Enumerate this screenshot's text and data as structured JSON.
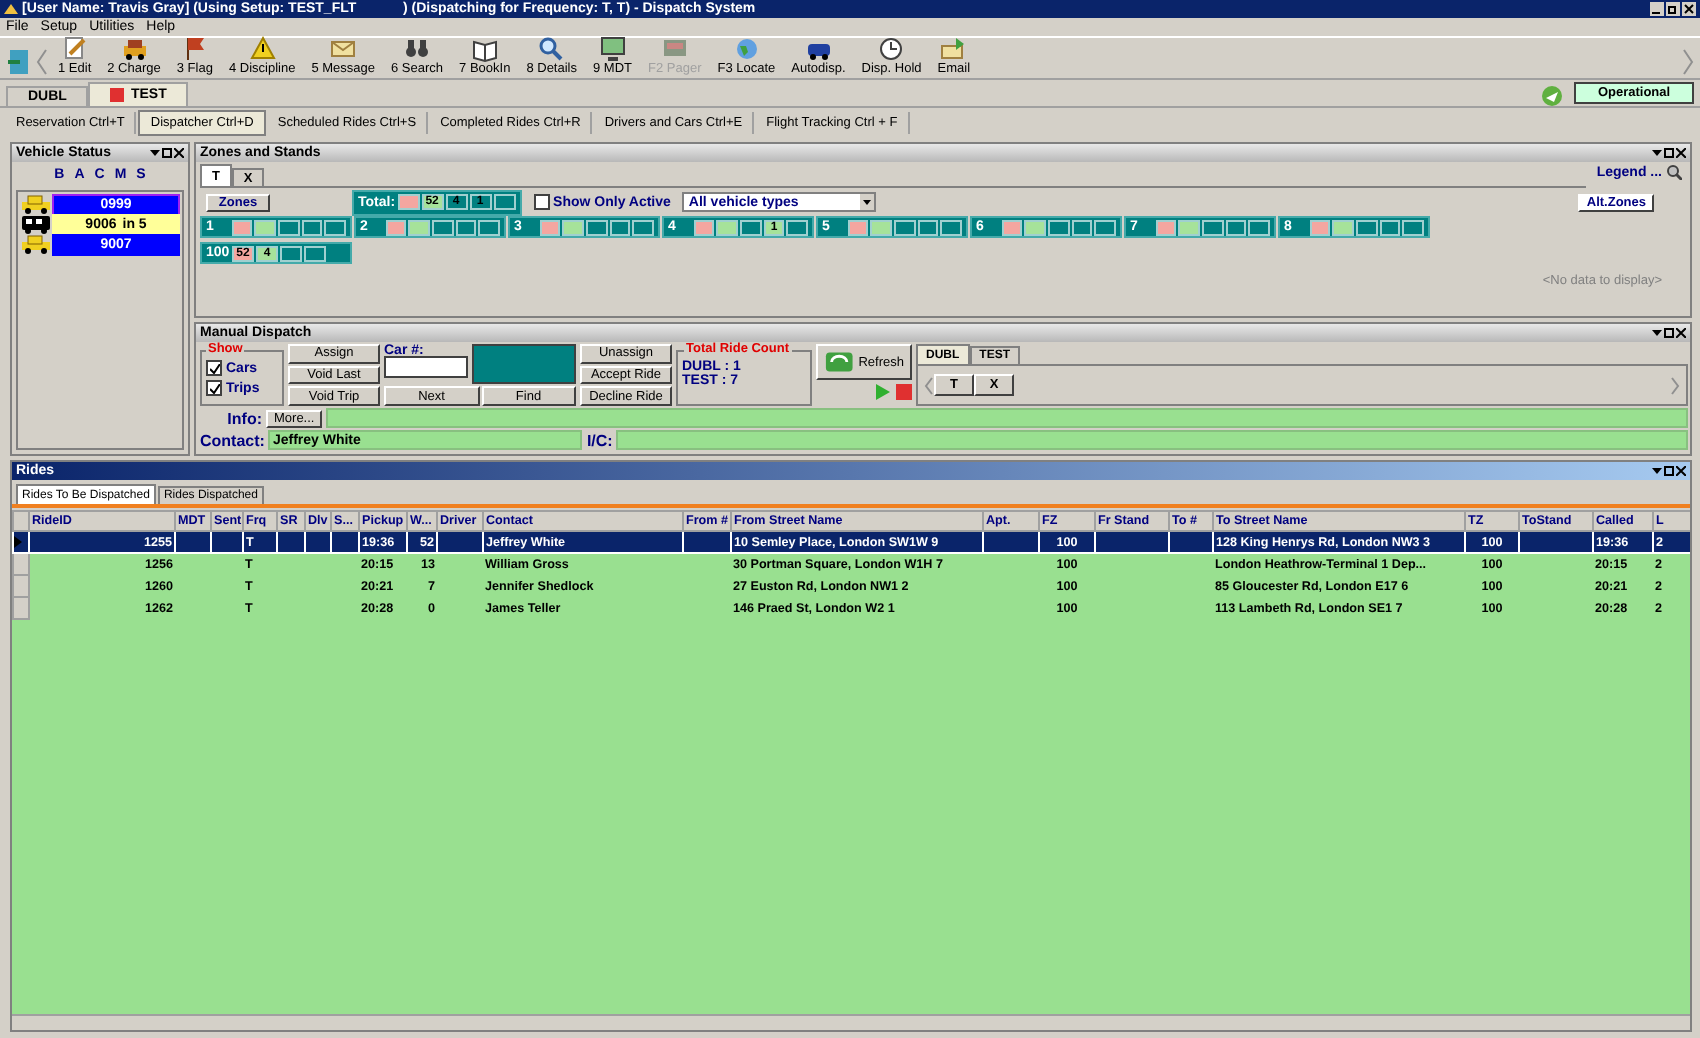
{
  "window": {
    "title": "[User Name: Travis Gray] (Using Setup: TEST_FLT            ) (Dispatching for Frequency: T, T) - Dispatch System"
  },
  "menu": [
    "File",
    "Setup",
    "Utilities",
    "Help"
  ],
  "toolbar": [
    {
      "label": "1 Edit",
      "disabled": false
    },
    {
      "label": "2 Charge",
      "disabled": false
    },
    {
      "label": "3 Flag",
      "disabled": false
    },
    {
      "label": "4 Discipline",
      "disabled": false
    },
    {
      "label": "5 Message",
      "disabled": false
    },
    {
      "label": "6 Search",
      "disabled": false
    },
    {
      "label": "7 BookIn",
      "disabled": false
    },
    {
      "label": "8 Details",
      "disabled": false
    },
    {
      "label": "9 MDT",
      "disabled": false
    },
    {
      "label": "F2 Pager",
      "disabled": true
    },
    {
      "label": "F3 Locate",
      "disabled": false
    },
    {
      "label": "Autodisp.",
      "disabled": false
    },
    {
      "label": "Disp. Hold",
      "disabled": false
    },
    {
      "label": "Email",
      "disabled": false
    }
  ],
  "frequency_tabs": [
    {
      "label": "DUBL",
      "selected": false
    },
    {
      "label": "TEST",
      "selected": true
    }
  ],
  "status_button": {
    "label": "Operational"
  },
  "function_tabs": [
    {
      "label": "Reservation Ctrl+T",
      "selected": false
    },
    {
      "label": "Dispatcher Ctrl+D",
      "selected": true
    },
    {
      "label": "Scheduled Rides Ctrl+S",
      "selected": false
    },
    {
      "label": "Completed Rides Ctrl+R",
      "selected": false
    },
    {
      "label": "Drivers and Cars Ctrl+E",
      "selected": false
    },
    {
      "label": "Flight Tracking Ctrl + F",
      "selected": false
    }
  ],
  "vehicle_status": {
    "title": "Vehicle Status",
    "columns": [
      "B",
      "A",
      "C",
      "M",
      "S"
    ],
    "vehicles": [
      {
        "number": "0999",
        "kind": "taxi",
        "color": "#0000ff",
        "selected": true
      },
      {
        "number": "9006",
        "note": "in 5",
        "kind": "van",
        "color": "#ffff99",
        "selected": false
      },
      {
        "number": "9007",
        "kind": "taxi",
        "color": "#0000ff",
        "selected": false
      }
    ]
  },
  "zones_and_stands": {
    "title": "Zones and Stands",
    "tabs": [
      {
        "label": "T",
        "selected": true
      },
      {
        "label": "X",
        "selected": false
      }
    ],
    "legend": "Legend ...",
    "zones_button": "Zones",
    "total": {
      "label": "Total:",
      "cells": [
        {
          "color": "#f4a6a0"
        },
        {
          "color": "#a6e29a",
          "text": "52"
        },
        {
          "color": "#008080",
          "text": "4"
        },
        {
          "color": "#008080",
          "text": "1"
        },
        {
          "color": "#008080"
        }
      ]
    },
    "show_only_active": {
      "label": "Show Only Active",
      "checked": false
    },
    "vehicle_type": {
      "value": "All vehicle types"
    },
    "alt_zones": "Alt.Zones",
    "zones": [
      {
        "label": "1",
        "cells": [
          {
            "color": "#f4a6a0"
          },
          {
            "color": "#a6e29a"
          },
          {
            "color": "#008080"
          },
          {
            "color": "#008080"
          },
          {
            "color": "#008080"
          }
        ]
      },
      {
        "label": "2",
        "cells": [
          {
            "color": "#f4a6a0"
          },
          {
            "color": "#a6e29a"
          },
          {
            "color": "#008080"
          },
          {
            "color": "#008080"
          },
          {
            "color": "#008080"
          }
        ]
      },
      {
        "label": "3",
        "cells": [
          {
            "color": "#f4a6a0"
          },
          {
            "color": "#a6e29a"
          },
          {
            "color": "#008080"
          },
          {
            "color": "#008080"
          },
          {
            "color": "#008080"
          }
        ]
      },
      {
        "label": "4",
        "cells": [
          {
            "color": "#f4a6a0"
          },
          {
            "color": "#a6e29a"
          },
          {
            "color": "#008080"
          },
          {
            "color": "#a6e29a",
            "text": "1"
          },
          {
            "color": "#008080"
          }
        ]
      },
      {
        "label": "5",
        "cells": [
          {
            "color": "#f4a6a0"
          },
          {
            "color": "#a6e29a"
          },
          {
            "color": "#008080"
          },
          {
            "color": "#008080"
          },
          {
            "color": "#008080"
          }
        ]
      },
      {
        "label": "6",
        "cells": [
          {
            "color": "#f4a6a0"
          },
          {
            "color": "#a6e29a"
          },
          {
            "color": "#008080"
          },
          {
            "color": "#008080"
          },
          {
            "color": "#008080"
          }
        ]
      },
      {
        "label": "7",
        "cells": [
          {
            "color": "#f4a6a0"
          },
          {
            "color": "#a6e29a"
          },
          {
            "color": "#008080"
          },
          {
            "color": "#008080"
          },
          {
            "color": "#008080"
          }
        ]
      },
      {
        "label": "8",
        "cells": [
          {
            "color": "#f4a6a0"
          },
          {
            "color": "#a6e29a"
          },
          {
            "color": "#008080"
          },
          {
            "color": "#008080"
          },
          {
            "color": "#008080"
          }
        ]
      },
      {
        "label": "100",
        "cells": [
          {
            "color": "#f4a6a0",
            "text": "52"
          },
          {
            "color": "#a6e29a",
            "text": "4"
          },
          {
            "color": "#008080"
          },
          {
            "color": "#008080"
          }
        ]
      }
    ],
    "empty_message": "<No data to display>"
  },
  "manual_dispatch": {
    "title": "Manual Dispatch",
    "show": {
      "label": "Show",
      "options": [
        {
          "label": "Cars",
          "checked": true
        },
        {
          "label": "Trips",
          "checked": true
        }
      ]
    },
    "left_buttons": [
      "Assign",
      "Void Last",
      "Void Trip"
    ],
    "car_label": "Car #:",
    "middle_buttons": [
      "Next",
      "Find"
    ],
    "right_buttons": [
      "Unassign",
      "Accept Ride",
      "Decline Ride"
    ],
    "ride_count": {
      "label": "Total Ride Count",
      "lines": [
        "DUBL : 1",
        "TEST : 7"
      ]
    },
    "refresh": "Refresh",
    "tabs": [
      {
        "label": "DUBL",
        "selected": true
      },
      {
        "label": "TEST",
        "selected": false
      }
    ],
    "frequency_buttons": [
      "T",
      "X"
    ],
    "info": {
      "label": "Info:",
      "button": "More..."
    },
    "contact": {
      "label": "Contact:",
      "value": "Jeffrey White"
    },
    "ic": {
      "label": "I/C:"
    }
  },
  "rides": {
    "title": "Rides",
    "tabs": [
      {
        "label": "Rides To Be Dispatched",
        "selected": true
      },
      {
        "label": "Rides Dispatched",
        "selected": false
      }
    ],
    "columns": [
      "RideID",
      "MDT",
      "Sent",
      "Frq",
      "SR",
      "Dlv",
      "S...",
      "Pickup",
      "W...",
      "Driver",
      "Contact",
      "From #",
      "From Street Name",
      "Apt.",
      "FZ",
      "Fr Stand",
      "To #",
      "To Street Name",
      "TZ",
      "ToStand",
      "Called",
      "L"
    ],
    "rows": [
      {
        "selected": true,
        "cells": [
          "1255",
          null,
          null,
          "T",
          null,
          null,
          null,
          "19:36",
          "52",
          null,
          "Jeffrey White",
          null,
          "10 Semley Place, London SW1W 9",
          null,
          "100",
          null,
          null,
          "128 King Henrys Rd, London NW3 3",
          "100",
          null,
          "19:36",
          "2"
        ]
      },
      {
        "selected": false,
        "cells": [
          "1256",
          null,
          null,
          "T",
          null,
          null,
          null,
          "20:15",
          "13",
          null,
          "William Gross",
          null,
          "30 Portman Square, London W1H 7",
          null,
          "100",
          null,
          null,
          "London Heathrow-Terminal 1 Dep...",
          "100",
          null,
          "20:15",
          "2"
        ]
      },
      {
        "selected": false,
        "cells": [
          "1260",
          null,
          null,
          "T",
          null,
          null,
          null,
          "20:21",
          "7",
          null,
          "Jennifer Shedlock",
          null,
          "27 Euston Rd, London NW1 2",
          null,
          "100",
          null,
          null,
          "85 Gloucester Rd, London E17 6",
          "100",
          null,
          "20:21",
          "2"
        ]
      },
      {
        "selected": false,
        "cells": [
          "1262",
          null,
          null,
          "T",
          null,
          null,
          null,
          "20:28",
          "0",
          null,
          "James Teller",
          null,
          "146 Praed St, London W2 1",
          null,
          "100",
          null,
          null,
          "113 Lambeth Rd, London SE1 7",
          "100",
          null,
          "20:28",
          "2"
        ]
      }
    ]
  }
}
